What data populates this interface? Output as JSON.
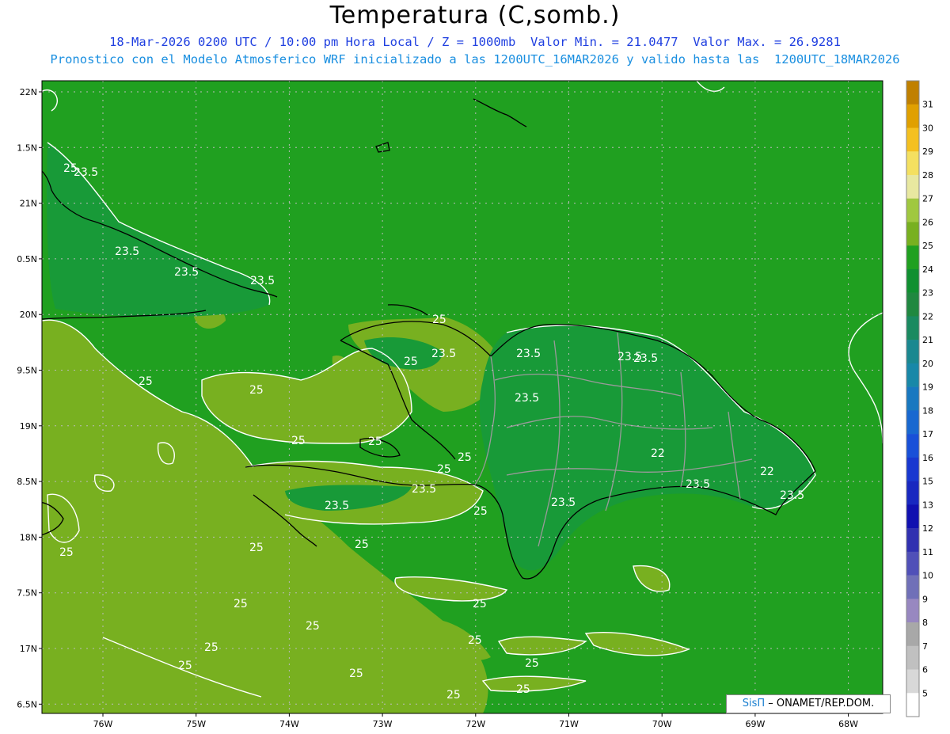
{
  "title": "Temperatura (C,somb.)",
  "subtitle": "18-Mar-2026 0200 UTC / 10:00 pm Hora Local / Z = 1000mb  Valor Min. = 21.0477  Valor Max. = 26.9281",
  "subtitle2": "Pronostico con el Modelo Atmosferico WRF inicializado a las 1200UTC_16MAR2026 y valido hasta las  1200UTC_18MAR2026",
  "credit": {
    "brand": "SisΠ",
    "org": " – ONAMET/REP.DOM."
  },
  "lat_labels": [
    "22N",
    "1.5N",
    "21N",
    "0.5N",
    "20N",
    "9.5N",
    "19N",
    "8.5N",
    "18N",
    "7.5N",
    "17N",
    "6.5N"
  ],
  "lon_labels": [
    "76W",
    "75W",
    "74W",
    "73W",
    "72W",
    "71W",
    "70W",
    "69W",
    "68W"
  ],
  "colorbar": {
    "labels": [
      "31",
      "30",
      "29",
      "28",
      "27",
      "26",
      "25",
      "24",
      "23",
      "22",
      "21",
      "20",
      "19",
      "18",
      "17",
      "16",
      "15",
      "13",
      "12",
      "11",
      "10",
      "9",
      "8",
      "7",
      "6",
      "5"
    ],
    "colors": [
      "#c08000",
      "#e0a000",
      "#f4c020",
      "#f4e060",
      "#e8e8a0",
      "#a0c840",
      "#78b020",
      "#20a020",
      "#109030",
      "#208840",
      "#1a8a60",
      "#1a8890",
      "#1888a8",
      "#1878c0",
      "#1868d0",
      "#1850d8",
      "#1838d0",
      "#1828c0",
      "#1010b0",
      "#3030b0",
      "#5050b8",
      "#7070b8",
      "#9888c0",
      "#a8a8a8",
      "#c0c0c0",
      "#d8d8d8",
      "#ffffff"
    ]
  },
  "contour_labels": [
    {
      "text": "23.5"
    },
    {
      "text": "23.5"
    },
    {
      "text": "23.5"
    },
    {
      "text": "23.5"
    },
    {
      "text": "25"
    },
    {
      "text": "25"
    },
    {
      "text": "23.5"
    },
    {
      "text": "25"
    },
    {
      "text": "23.5"
    },
    {
      "text": "23.5"
    },
    {
      "text": "25"
    },
    {
      "text": "23.5"
    },
    {
      "text": "25"
    },
    {
      "text": "25"
    },
    {
      "text": "25"
    },
    {
      "text": "25"
    },
    {
      "text": "23.5"
    },
    {
      "text": "23.5"
    },
    {
      "text": "25"
    },
    {
      "text": "22"
    },
    {
      "text": "22"
    },
    {
      "text": "23.5"
    },
    {
      "text": "23.5"
    },
    {
      "text": "23.5"
    },
    {
      "text": "25"
    },
    {
      "text": "25"
    },
    {
      "text": "25"
    },
    {
      "text": "25"
    },
    {
      "text": "25"
    },
    {
      "text": "25"
    },
    {
      "text": "25"
    },
    {
      "text": "25"
    },
    {
      "text": "25"
    },
    {
      "text": "25"
    },
    {
      "text": "25"
    },
    {
      "text": "25"
    },
    {
      "text": "25"
    },
    {
      "text": "25"
    },
    {
      "text": "23.5"
    }
  ]
}
